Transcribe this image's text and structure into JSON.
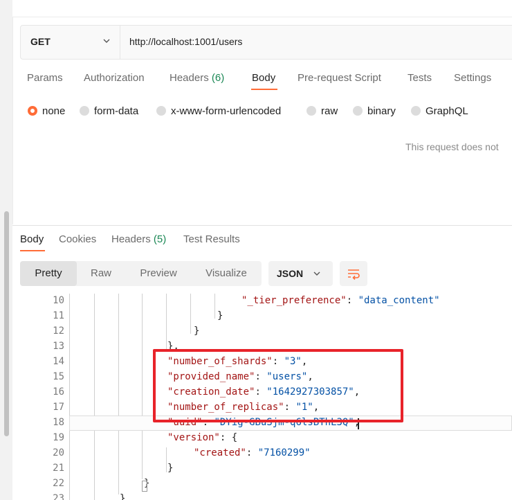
{
  "request": {
    "method": "GET",
    "url": "http://localhost:1001/users"
  },
  "request_tabs": [
    {
      "label": "Params"
    },
    {
      "label": "Authorization"
    },
    {
      "label": "Headers",
      "count": "(6)"
    },
    {
      "label": "Body"
    },
    {
      "label": "Pre-request Script"
    },
    {
      "label": "Tests"
    },
    {
      "label": "Settings"
    }
  ],
  "body_types": [
    "none",
    "form-data",
    "x-www-form-urlencoded",
    "raw",
    "binary",
    "GraphQL"
  ],
  "body_type_selected": "none",
  "body_hint": "This request does not",
  "response_tabs": [
    {
      "label": "Body"
    },
    {
      "label": "Cookies"
    },
    {
      "label": "Headers",
      "count": "(5)"
    },
    {
      "label": "Test Results"
    }
  ],
  "view_modes": [
    "Pretty",
    "Raw",
    "Preview",
    "Visualize"
  ],
  "view_selected": "Pretty",
  "format": "JSON",
  "accent_color": "#ff6c37",
  "annotation_color": "#e8232a",
  "icons": {
    "method_dropdown": "chevron-down-icon",
    "format_dropdown": "chevron-down-icon",
    "wrap": "wrap-lines-icon"
  },
  "code_lines": [
    {
      "n": "10",
      "key": "\"_tier_preference\"",
      "sep": ": ",
      "val": "\"data_content\"",
      "tail": ""
    },
    {
      "n": "11",
      "key": "",
      "sep": "",
      "val": "",
      "tail": "}"
    },
    {
      "n": "12",
      "key": "",
      "sep": "",
      "val": "",
      "tail": "}"
    },
    {
      "n": "13",
      "key": "",
      "sep": "",
      "val": "",
      "tail": "},"
    },
    {
      "n": "14",
      "key": "\"number_of_shards\"",
      "sep": ": ",
      "val": "\"3\"",
      "tail": ","
    },
    {
      "n": "15",
      "key": "\"provided_name\"",
      "sep": ": ",
      "val": "\"users\"",
      "tail": ","
    },
    {
      "n": "16",
      "key": "\"creation_date\"",
      "sep": ": ",
      "val": "\"1642927303857\"",
      "tail": ","
    },
    {
      "n": "17",
      "key": "\"number_of_replicas\"",
      "sep": ": ",
      "val": "\"1\"",
      "tail": ","
    },
    {
      "n": "18",
      "key": "\"uuid\"",
      "sep": ": ",
      "val": "\"DYig-GBuSjm-q6lsBThL3Q\"",
      "tail": ","
    },
    {
      "n": "19",
      "key": "\"version\"",
      "sep": ": ",
      "val": "",
      "tail": "{"
    },
    {
      "n": "20",
      "key": "\"created\"",
      "sep": ": ",
      "val": "\"7160299\"",
      "tail": ""
    },
    {
      "n": "21",
      "key": "",
      "sep": "",
      "val": "",
      "tail": "}"
    },
    {
      "n": "22",
      "key": "",
      "sep": "",
      "val": "",
      "tail": "}"
    },
    {
      "n": "23",
      "key": "",
      "sep": "",
      "val": "",
      "tail": "}"
    }
  ]
}
